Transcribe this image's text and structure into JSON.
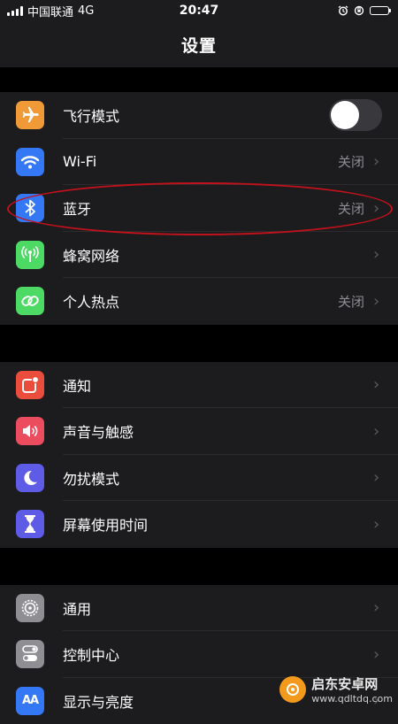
{
  "status_bar": {
    "carrier": "中国联通",
    "network": "4G",
    "time": "20:47"
  },
  "nav": {
    "title": "设置"
  },
  "groups": [
    {
      "items": [
        {
          "label": "飞行模式",
          "icon": "airplane-icon",
          "color": "#f09a37",
          "control": "toggle",
          "toggle_on": false
        },
        {
          "label": "Wi-Fi",
          "icon": "wifi-icon",
          "color": "#3478f6",
          "value": "关闭"
        },
        {
          "label": "蓝牙",
          "icon": "bluetooth-icon",
          "color": "#3478f6",
          "value": "关闭"
        },
        {
          "label": "蜂窝网络",
          "icon": "cellular-icon",
          "color": "#4cd964",
          "value": ""
        },
        {
          "label": "个人热点",
          "icon": "hotspot-icon",
          "color": "#4cd964",
          "value": "关闭"
        }
      ]
    },
    {
      "items": [
        {
          "label": "通知",
          "icon": "notifications-icon",
          "color": "#eb4d3d"
        },
        {
          "label": "声音与触感",
          "icon": "sound-icon",
          "color": "#eb4d5f"
        },
        {
          "label": "勿扰模式",
          "icon": "moon-icon",
          "color": "#5e5ce6"
        },
        {
          "label": "屏幕使用时间",
          "icon": "hourglass-icon",
          "color": "#5e5ce6"
        }
      ]
    },
    {
      "items": [
        {
          "label": "通用",
          "icon": "gear-icon",
          "color": "#8e8e93"
        },
        {
          "label": "控制中心",
          "icon": "switches-icon",
          "color": "#8e8e93"
        },
        {
          "label": "显示与亮度",
          "icon": "display-icon",
          "color": "#3478f6"
        }
      ]
    }
  ],
  "watermark": {
    "title": "启东安卓网",
    "url": "www.qdltdq.com"
  }
}
